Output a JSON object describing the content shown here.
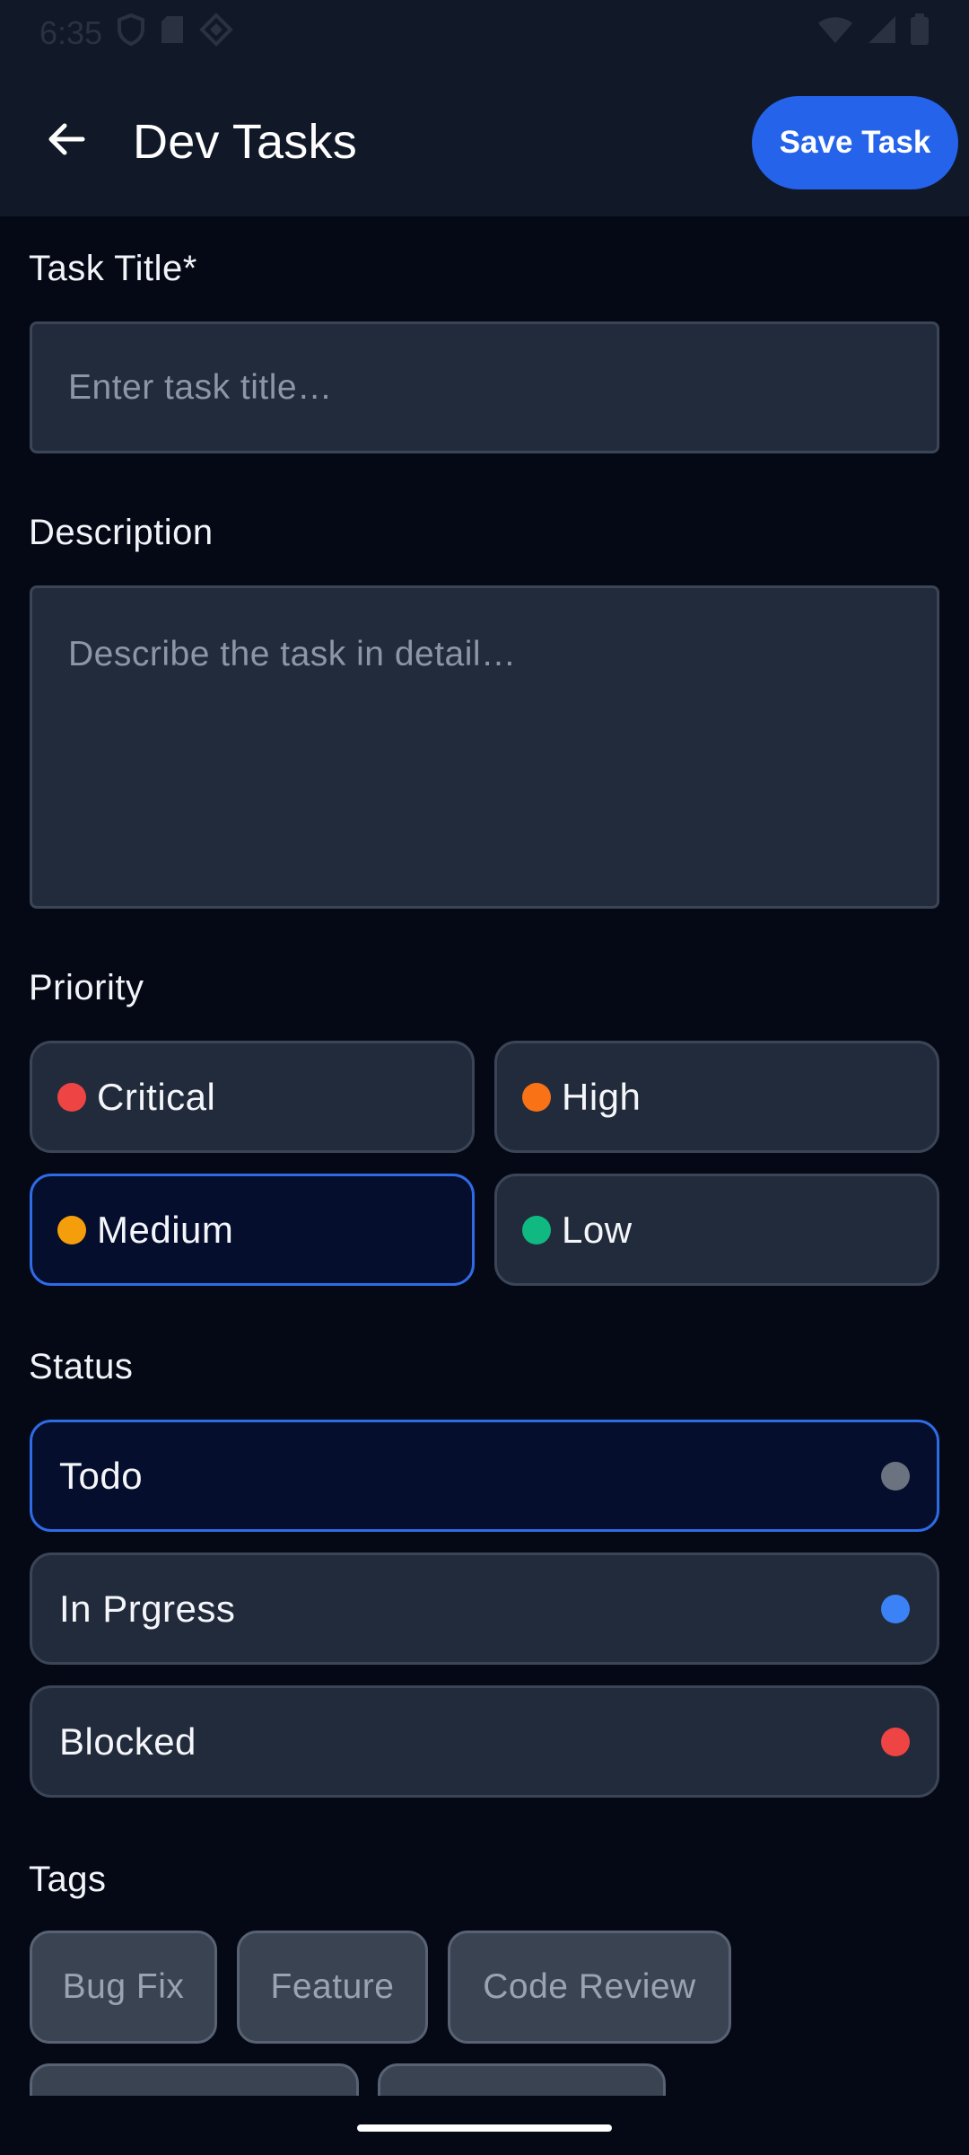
{
  "status_bar": {
    "time": "6:35"
  },
  "header": {
    "title": "Dev Tasks",
    "save_label": "Save Task",
    "back_icon": "arrow-left-icon"
  },
  "form": {
    "title_label": "Task Title*",
    "title_placeholder": "Enter task title…",
    "description_label": "Description",
    "description_placeholder": "Describe the task in detail…",
    "priority_label": "Priority",
    "priority_options": [
      {
        "label": "Critical",
        "color": "#EF4444",
        "selected": false
      },
      {
        "label": "High",
        "color": "#F97316",
        "selected": false
      },
      {
        "label": "Medium",
        "color": "#F59E0B",
        "selected": true
      },
      {
        "label": "Low",
        "color": "#10B981",
        "selected": false
      }
    ],
    "status_label": "Status",
    "status_options": [
      {
        "label": "Todo",
        "color": "#6B7280",
        "selected": true
      },
      {
        "label": "In Prgress",
        "color": "#3B82F6",
        "selected": false
      },
      {
        "label": "Blocked",
        "color": "#EF4444",
        "selected": false
      }
    ],
    "tags_label": "Tags",
    "tags": [
      {
        "label": "Bug Fix"
      },
      {
        "label": "Feature"
      },
      {
        "label": "Code Review"
      },
      {
        "label": ""
      },
      {
        "label": ""
      }
    ]
  },
  "colors": {
    "accent": "#2563EB",
    "background": "#050915",
    "surface": "#222B3B",
    "header": "#111827"
  }
}
